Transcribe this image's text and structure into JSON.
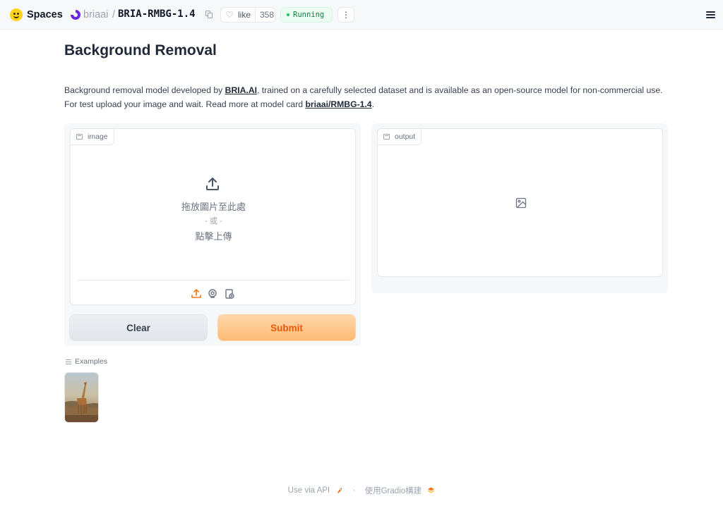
{
  "header": {
    "brand": "Spaces",
    "org": "briaai",
    "separator": "/",
    "repo": "BRIA-RMBG-1.4",
    "like_label": "like",
    "like_count": "358",
    "status": "Running",
    "more_label": "⋮"
  },
  "app": {
    "title": "Background Removal",
    "desc_part1": "Background removal model developed by ",
    "desc_link1": "BRIA.AI",
    "desc_part2": ", trained on a carefully selected dataset and is available as an open-source model for non-commercial use.",
    "desc_part3": "For test upload your image and wait. Read more at model card ",
    "desc_link2": "briaai/RMBG-1.4",
    "desc_part4": "."
  },
  "input": {
    "label": "image",
    "drop_text": "拖放圖片至此處",
    "or_text": "- 或 -",
    "click_text": "點擊上傳"
  },
  "output": {
    "label": "output"
  },
  "buttons": {
    "clear": "Clear",
    "submit": "Submit"
  },
  "examples": {
    "label": "Examples"
  },
  "footer": {
    "api": "Use via API",
    "built": "使用Gradio構建"
  },
  "colors": {
    "accent": "#f97316",
    "status_green": "#22c55e",
    "brand_yellow": "#ffd21e"
  }
}
